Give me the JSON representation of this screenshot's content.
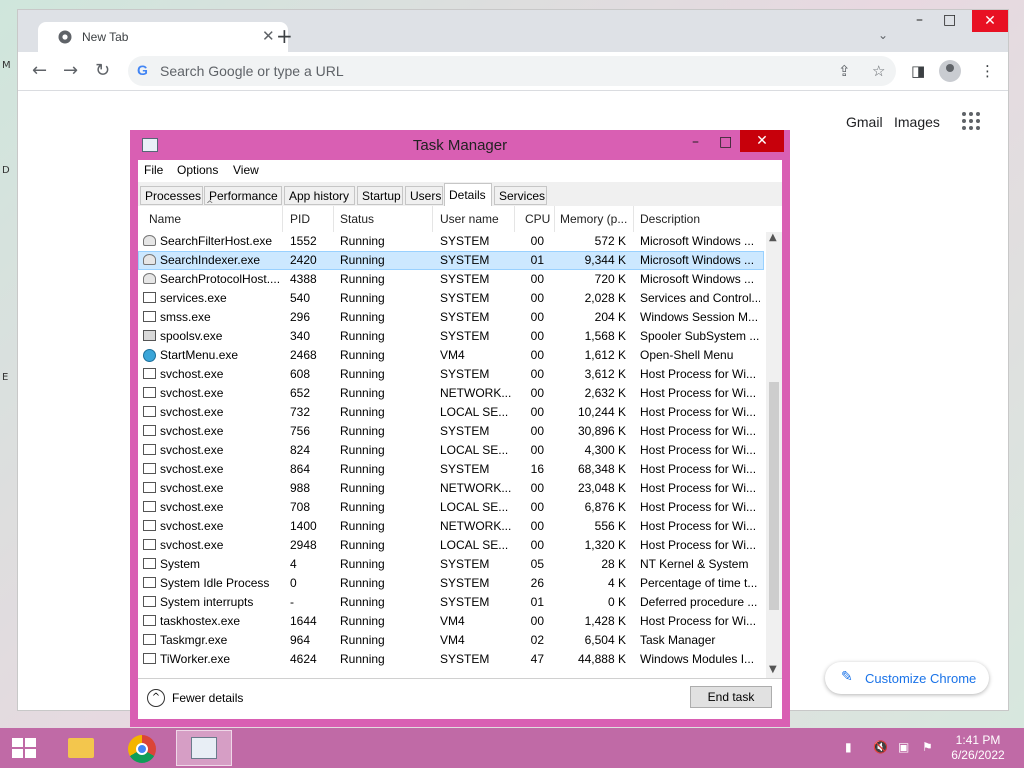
{
  "browser": {
    "tab_title": "New Tab",
    "omnibox_placeholder": "Search Google or type a URL",
    "omnibox_g": "G",
    "gmail": "Gmail",
    "images": "Images",
    "customize": "Customize Chrome"
  },
  "taskmanager": {
    "title": "Task Manager",
    "menu": [
      "File",
      "Options",
      "View"
    ],
    "tabs": [
      "Processes",
      "Performance",
      "App history",
      "Startup",
      "Users",
      "Details",
      "Services"
    ],
    "active_tab": "Details",
    "columns": [
      "Name",
      "PID",
      "Status",
      "User name",
      "CPU",
      "Memory (p...",
      "Description"
    ],
    "rows": [
      {
        "name": "SearchFilterHost.exe",
        "pid": "1552",
        "status": "Running",
        "user": "SYSTEM",
        "cpu": "00",
        "mem": "572 K",
        "desc": "Microsoft Windows ...",
        "icon": "user"
      },
      {
        "name": "SearchIndexer.exe",
        "pid": "2420",
        "status": "Running",
        "user": "SYSTEM",
        "cpu": "01",
        "mem": "9,344 K",
        "desc": "Microsoft Windows ...",
        "icon": "user"
      },
      {
        "name": "SearchProtocolHost....",
        "pid": "4388",
        "status": "Running",
        "user": "SYSTEM",
        "cpu": "00",
        "mem": "720 K",
        "desc": "Microsoft Windows ...",
        "icon": "user"
      },
      {
        "name": "services.exe",
        "pid": "540",
        "status": "Running",
        "user": "SYSTEM",
        "cpu": "00",
        "mem": "2,028 K",
        "desc": "Services and Control...",
        "icon": "window"
      },
      {
        "name": "smss.exe",
        "pid": "296",
        "status": "Running",
        "user": "SYSTEM",
        "cpu": "00",
        "mem": "204 K",
        "desc": "Windows Session M...",
        "icon": "window"
      },
      {
        "name": "spoolsv.exe",
        "pid": "340",
        "status": "Running",
        "user": "SYSTEM",
        "cpu": "00",
        "mem": "1,568 K",
        "desc": "Spooler SubSystem ...",
        "icon": "printer"
      },
      {
        "name": "StartMenu.exe",
        "pid": "2468",
        "status": "Running",
        "user": "VM4",
        "cpu": "00",
        "mem": "1,612 K",
        "desc": "Open-Shell Menu",
        "icon": "globe"
      },
      {
        "name": "svchost.exe",
        "pid": "608",
        "status": "Running",
        "user": "SYSTEM",
        "cpu": "00",
        "mem": "3,612 K",
        "desc": "Host Process for Wi...",
        "icon": "window"
      },
      {
        "name": "svchost.exe",
        "pid": "652",
        "status": "Running",
        "user": "NETWORK...",
        "cpu": "00",
        "mem": "2,632 K",
        "desc": "Host Process for Wi...",
        "icon": "window"
      },
      {
        "name": "svchost.exe",
        "pid": "732",
        "status": "Running",
        "user": "LOCAL SE...",
        "cpu": "00",
        "mem": "10,244 K",
        "desc": "Host Process for Wi...",
        "icon": "window"
      },
      {
        "name": "svchost.exe",
        "pid": "756",
        "status": "Running",
        "user": "SYSTEM",
        "cpu": "00",
        "mem": "30,896 K",
        "desc": "Host Process for Wi...",
        "icon": "window"
      },
      {
        "name": "svchost.exe",
        "pid": "824",
        "status": "Running",
        "user": "LOCAL SE...",
        "cpu": "00",
        "mem": "4,300 K",
        "desc": "Host Process for Wi...",
        "icon": "window"
      },
      {
        "name": "svchost.exe",
        "pid": "864",
        "status": "Running",
        "user": "SYSTEM",
        "cpu": "16",
        "mem": "68,348 K",
        "desc": "Host Process for Wi...",
        "icon": "window"
      },
      {
        "name": "svchost.exe",
        "pid": "988",
        "status": "Running",
        "user": "NETWORK...",
        "cpu": "00",
        "mem": "23,048 K",
        "desc": "Host Process for Wi...",
        "icon": "window"
      },
      {
        "name": "svchost.exe",
        "pid": "708",
        "status": "Running",
        "user": "LOCAL SE...",
        "cpu": "00",
        "mem": "6,876 K",
        "desc": "Host Process for Wi...",
        "icon": "window"
      },
      {
        "name": "svchost.exe",
        "pid": "1400",
        "status": "Running",
        "user": "NETWORK...",
        "cpu": "00",
        "mem": "556 K",
        "desc": "Host Process for Wi...",
        "icon": "window"
      },
      {
        "name": "svchost.exe",
        "pid": "2948",
        "status": "Running",
        "user": "LOCAL SE...",
        "cpu": "00",
        "mem": "1,320 K",
        "desc": "Host Process for Wi...",
        "icon": "window"
      },
      {
        "name": "System",
        "pid": "4",
        "status": "Running",
        "user": "SYSTEM",
        "cpu": "05",
        "mem": "28 K",
        "desc": "NT Kernel & System",
        "icon": "window"
      },
      {
        "name": "System Idle Process",
        "pid": "0",
        "status": "Running",
        "user": "SYSTEM",
        "cpu": "26",
        "mem": "4 K",
        "desc": "Percentage of time t...",
        "icon": "window"
      },
      {
        "name": "System interrupts",
        "pid": "-",
        "status": "Running",
        "user": "SYSTEM",
        "cpu": "01",
        "mem": "0 K",
        "desc": "Deferred procedure ...",
        "icon": "window"
      },
      {
        "name": "taskhostex.exe",
        "pid": "1644",
        "status": "Running",
        "user": "VM4",
        "cpu": "00",
        "mem": "1,428 K",
        "desc": "Host Process for Wi...",
        "icon": "window"
      },
      {
        "name": "Taskmgr.exe",
        "pid": "964",
        "status": "Running",
        "user": "VM4",
        "cpu": "02",
        "mem": "6,504 K",
        "desc": "Task Manager",
        "icon": "window"
      },
      {
        "name": "TiWorker.exe",
        "pid": "4624",
        "status": "Running",
        "user": "SYSTEM",
        "cpu": "47",
        "mem": "44,888 K",
        "desc": "Windows Modules I...",
        "icon": "window"
      }
    ],
    "selected_row": 1,
    "fewer_details": "Fewer details",
    "end_task": "End task"
  },
  "taskbar": {
    "time": "1:41 PM",
    "date": "6/26/2022"
  },
  "colors": {
    "accent": "#d95fb3",
    "taskbar": "#c06aa6",
    "selection": "#cce8ff"
  }
}
